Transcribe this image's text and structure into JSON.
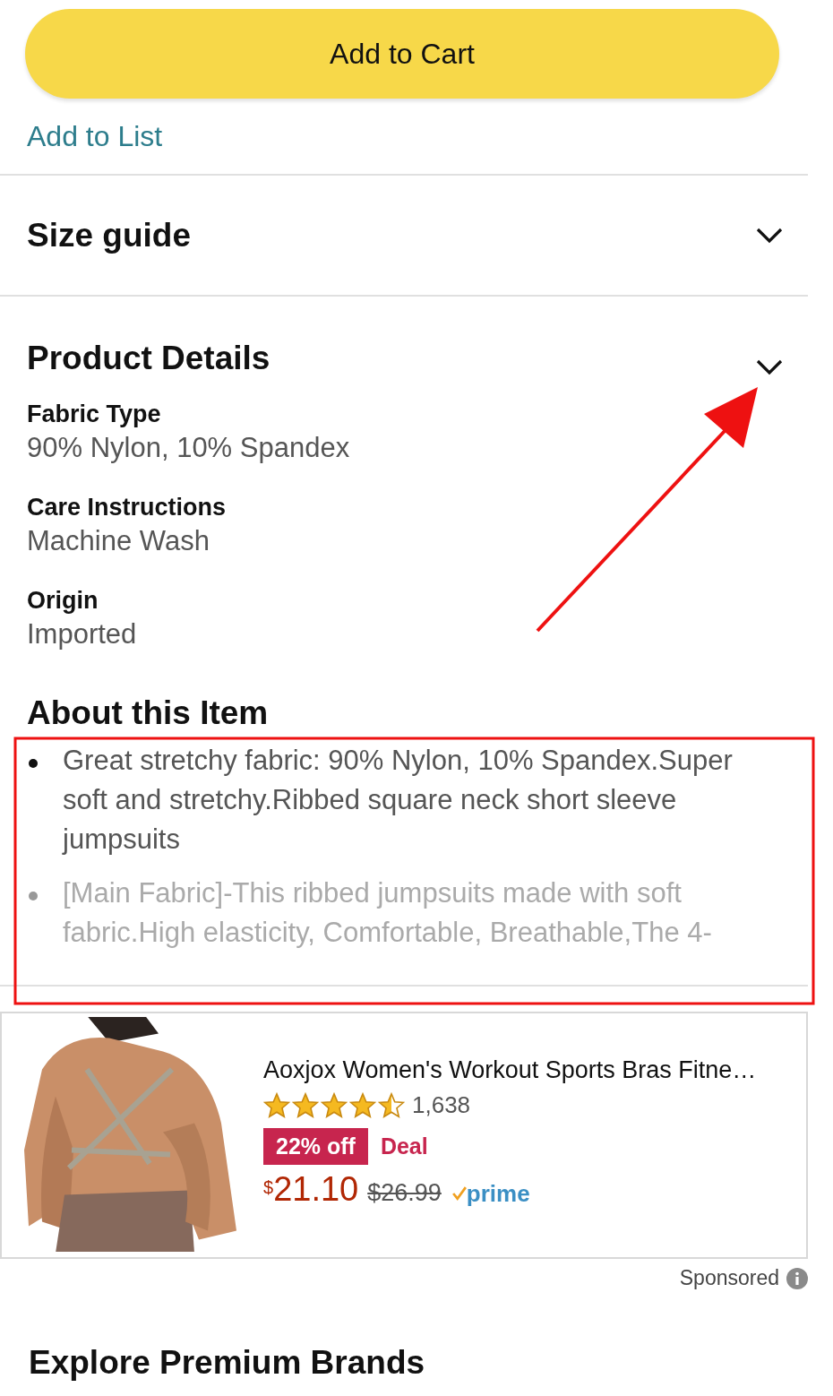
{
  "buttons": {
    "add_to_cart": "Add to Cart",
    "add_to_list": "Add to List"
  },
  "size_guide": {
    "title": "Size guide",
    "expanded": false
  },
  "product_details": {
    "title": "Product Details",
    "rows": [
      {
        "label": "Fabric Type",
        "value": "90% Nylon, 10% Spandex"
      },
      {
        "label": "Care Instructions",
        "value": "Machine Wash"
      },
      {
        "label": "Origin",
        "value": "Imported"
      }
    ]
  },
  "about": {
    "title": "About this Item",
    "bullets": [
      {
        "text": "Great stretchy fabric: 90% Nylon, 10% Spandex.Super soft and stretchy.Ribbed square neck short sleeve jumpsuits",
        "faded": false
      },
      {
        "text": "[Main Fabric]-This ribbed jumpsuits made with soft fabric.High elasticity, Comfortable, Breathable,The 4-",
        "faded": true
      }
    ]
  },
  "sponsored_product": {
    "title": "Aoxjox Women's Workout Sports Bras Fitne…",
    "stars": 4.5,
    "rating_count": "1,638",
    "discount_badge": "22% off",
    "deal_label": "Deal",
    "currency": "$",
    "price": "21.10",
    "list_price": "$26.99",
    "prime": "prime"
  },
  "sponsored_label": "Sponsored",
  "explore_title": "Explore Premium Brands"
}
